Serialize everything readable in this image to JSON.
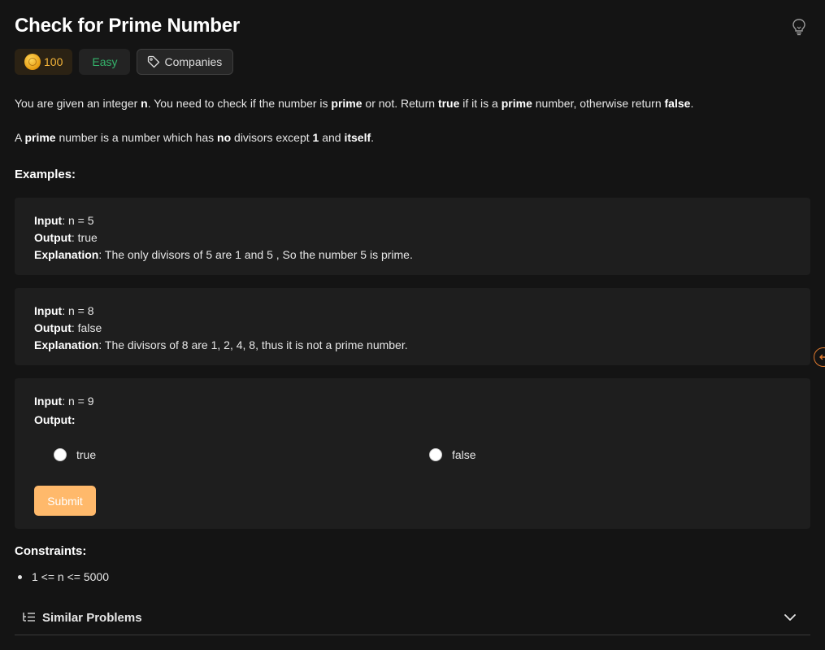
{
  "problem": {
    "title": "Check for Prime Number",
    "coins": "100",
    "difficulty": "Easy",
    "companies_label": "Companies"
  },
  "description": {
    "p1": [
      {
        "t": "You are given an integer ",
        "b": false
      },
      {
        "t": "n",
        "b": true
      },
      {
        "t": ". You need to check if the number is ",
        "b": false
      },
      {
        "t": "prime",
        "b": true
      },
      {
        "t": " or not. Return ",
        "b": false
      },
      {
        "t": "true",
        "b": true
      },
      {
        "t": " if it is a ",
        "b": false
      },
      {
        "t": "prime",
        "b": true
      },
      {
        "t": " number, otherwise return ",
        "b": false
      },
      {
        "t": "false",
        "b": true
      },
      {
        "t": ".",
        "b": false
      }
    ],
    "p2": [
      {
        "t": "A ",
        "b": false
      },
      {
        "t": "prime",
        "b": true
      },
      {
        "t": " number is a number which has ",
        "b": false
      },
      {
        "t": "no",
        "b": true
      },
      {
        "t": " divisors except ",
        "b": false
      },
      {
        "t": "1",
        "b": true
      },
      {
        "t": " and ",
        "b": false
      },
      {
        "t": "itself",
        "b": true
      },
      {
        "t": ".",
        "b": false
      }
    ]
  },
  "examples_heading": "Examples:",
  "examples": [
    {
      "input_label": "Input",
      "input": ": n = 5",
      "output_label": "Output",
      "output": ": true",
      "explanation_label": "Explanation",
      "explanation": ": The only divisors of 5 are 1 and 5 , So the number 5 is prime."
    },
    {
      "input_label": "Input",
      "input": ": n = 8",
      "output_label": "Output",
      "output": ": false",
      "explanation_label": "Explanation",
      "explanation": ": The divisors of 8 are 1, 2, 4, 8, thus it is not a prime number."
    }
  ],
  "quiz": {
    "input_label": "Input",
    "input": ": n = 9",
    "output_label": "Output:",
    "option_true": "true",
    "option_false": "false",
    "submit_label": "Submit"
  },
  "constraints_heading": "Constraints:",
  "constraints": [
    "1 <= n <= 5000"
  ],
  "similar_problems_label": "Similar Problems",
  "colors": {
    "accent": "#ffb96b",
    "easy": "#34b36b",
    "coins": "#f5b53a"
  }
}
